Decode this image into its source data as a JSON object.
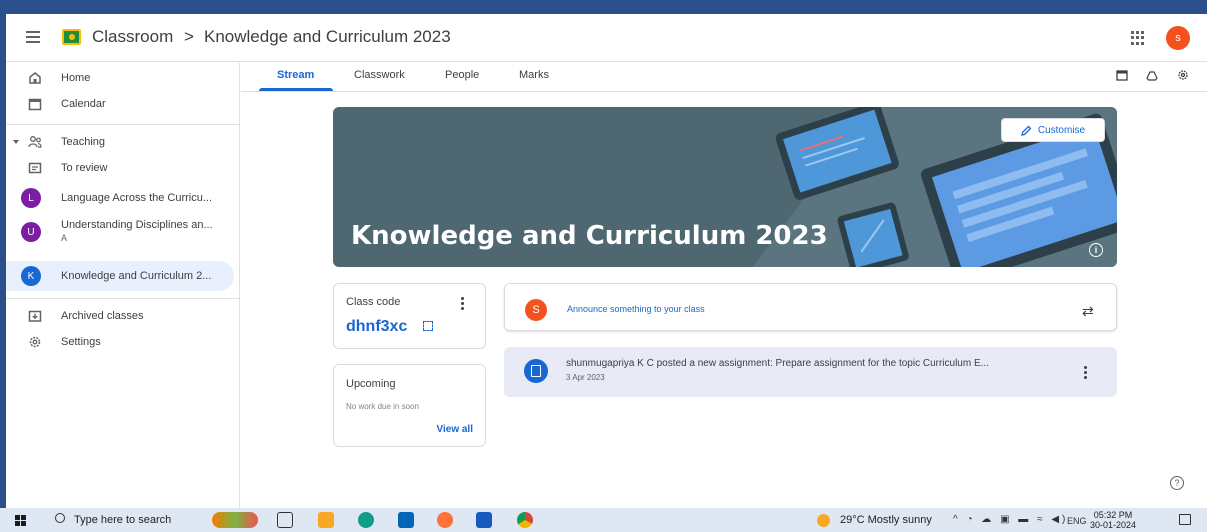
{
  "header": {
    "app_name": "Classroom",
    "separator": ">",
    "class_name": "Knowledge and Curriculum 2023",
    "avatar_letter": "s"
  },
  "sidebar": {
    "home": "Home",
    "calendar": "Calendar",
    "teaching": "Teaching",
    "to_review": "To review",
    "classes": [
      {
        "letter": "L",
        "label": "Language Across the Curricu...",
        "sub": "",
        "color": "#7b1fa2"
      },
      {
        "letter": "U",
        "label": "Understanding Disciplines an...",
        "sub": "A",
        "color": "#7b1fa2"
      },
      {
        "letter": "K",
        "label": "Knowledge and Curriculum 2...",
        "sub": "",
        "color": "#1967d2"
      }
    ],
    "archived": "Archived classes",
    "settings": "Settings"
  },
  "tabs": [
    "Stream",
    "Classwork",
    "People",
    "Marks"
  ],
  "banner": {
    "title": "Knowledge and Curriculum 2023",
    "customise_label": "Customise"
  },
  "class_code": {
    "label": "Class code",
    "value": "dhnf3xc"
  },
  "upcoming": {
    "title": "Upcoming",
    "empty_text": "No work due in soon",
    "view_all": "View all"
  },
  "announce": {
    "avatar_letter": "S",
    "placeholder": "Announce something to your class"
  },
  "post": {
    "text": "shunmugapriya K C posted a new assignment: Prepare assignment for the topic Curriculum E...",
    "date": "3 Apr 2023"
  },
  "taskbar": {
    "search_placeholder": "Type here to search",
    "weather": "29°C  Mostly sunny",
    "language": "ENG",
    "time": "05:32 PM",
    "date": "30-01-2024"
  },
  "colors": {
    "accent": "#1967d2",
    "avatar": "#f4511e",
    "banner_bg": "#4f6770",
    "desktop_bg": "#2b4f8a"
  }
}
